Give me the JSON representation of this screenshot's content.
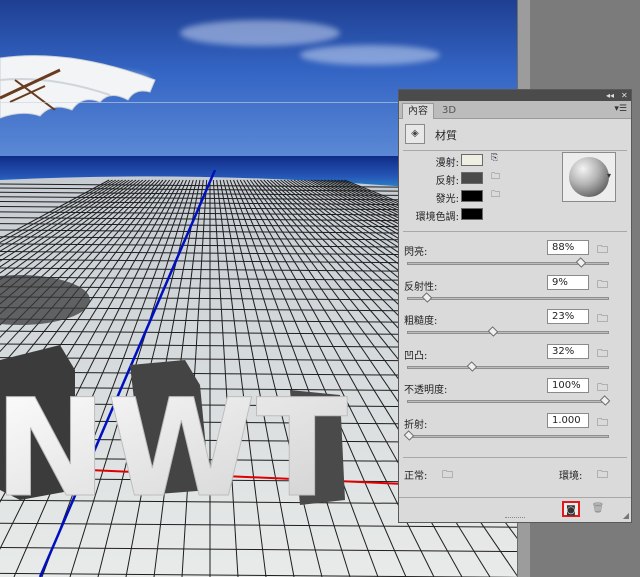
{
  "panel": {
    "tabs": [
      {
        "label": "內容",
        "active": true
      },
      {
        "label": "3D",
        "active": false
      }
    ],
    "title": "材質",
    "materials": [
      {
        "label": "漫射:",
        "swatch_color": "#efeee3",
        "has_texture": true
      },
      {
        "label": "反射:",
        "swatch_color": "#4a4a4a",
        "has_texture": false
      },
      {
        "label": "發光:",
        "swatch_color": "#000000",
        "has_texture": false
      },
      {
        "label": "環境色調:",
        "swatch_color": "#000000",
        "has_texture": false
      }
    ],
    "properties": [
      {
        "label": "閃亮:",
        "value": "88%",
        "level": 0.88
      },
      {
        "label": "反射性:",
        "value": "9%",
        "level": 0.09
      },
      {
        "label": "粗糙度:",
        "value": "23%",
        "level": 0.43
      },
      {
        "label": "凹凸:",
        "value": "32%",
        "level": 0.32
      },
      {
        "label": "不透明度:",
        "value": "100%",
        "level": 1.0
      },
      {
        "label": "折射:",
        "value": "1.000",
        "level": 0.0
      }
    ],
    "normal_label": "正常:",
    "environment_label": "環境:"
  },
  "scene": {
    "text_3d": "NWT",
    "colors": {
      "sky": "#2d5cbc",
      "sea": "#1c3f9e",
      "grid_line": "#1a1a1a",
      "floor": "#d8dcd8",
      "axis_blue": "#0010c0",
      "axis_red": "#e00000",
      "highlight": "#e01a1a"
    }
  },
  "icons": {
    "panel_menu": "panel-menu-icon",
    "material": "material-icon",
    "folder": "folder-icon",
    "new_material": "new-material-icon",
    "delete": "trash-icon"
  }
}
